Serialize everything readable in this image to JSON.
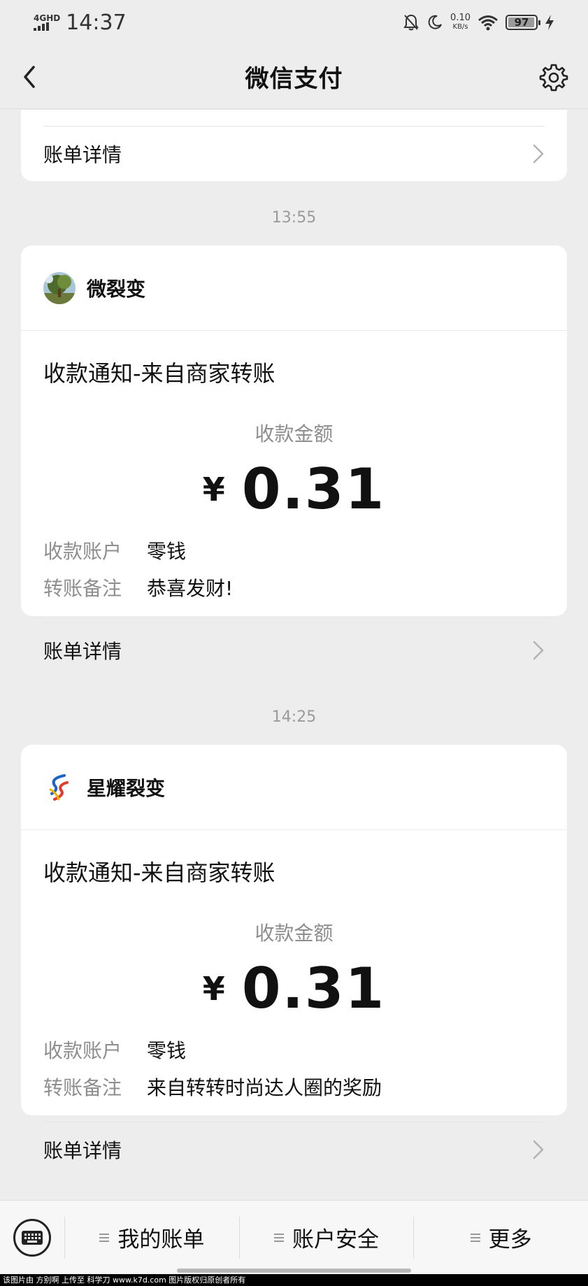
{
  "status_bar": {
    "network": "4GHD",
    "time": "14:37",
    "speed_value": "0.10",
    "speed_unit": "KB/s",
    "battery": "97",
    "battery_level": 0.97
  },
  "nav": {
    "title": "微信支付",
    "back_icon": "chevron-left-icon",
    "settings_icon": "gear-icon"
  },
  "messages": [
    {
      "partial": true,
      "detail_label": "账单详情"
    },
    {
      "time": "13:55",
      "merchant": "微裂变",
      "title": "收款通知-来自商家转账",
      "amount_label": "收款金额",
      "currency": "¥",
      "amount": "0.31",
      "rows": [
        {
          "key": "收款账户",
          "value": "零钱"
        },
        {
          "key": "转账备注",
          "value": "恭喜发财!"
        }
      ],
      "detail_label": "账单详情"
    },
    {
      "time": "14:25",
      "merchant": "星耀裂变",
      "title": "收款通知-来自商家转账",
      "amount_label": "收款金额",
      "currency": "¥",
      "amount": "0.31",
      "rows": [
        {
          "key": "收款账户",
          "value": "零钱"
        },
        {
          "key": "转账备注",
          "value": "来自转转时尚达人圈的奖励"
        }
      ],
      "detail_label": "账单详情"
    }
  ],
  "bottom_menu": {
    "keyboard_icon": "keyboard-icon",
    "items": [
      {
        "label": "我的账单"
      },
      {
        "label": "账户安全"
      },
      {
        "label": "更多"
      }
    ]
  },
  "watermark": "该图片由 方别啊 上传至 科学刀 www.k7d.com 图片版权归原创者所有",
  "colors": {
    "background": "#ededed",
    "card": "#ffffff",
    "muted_text": "#8e8e8e"
  }
}
